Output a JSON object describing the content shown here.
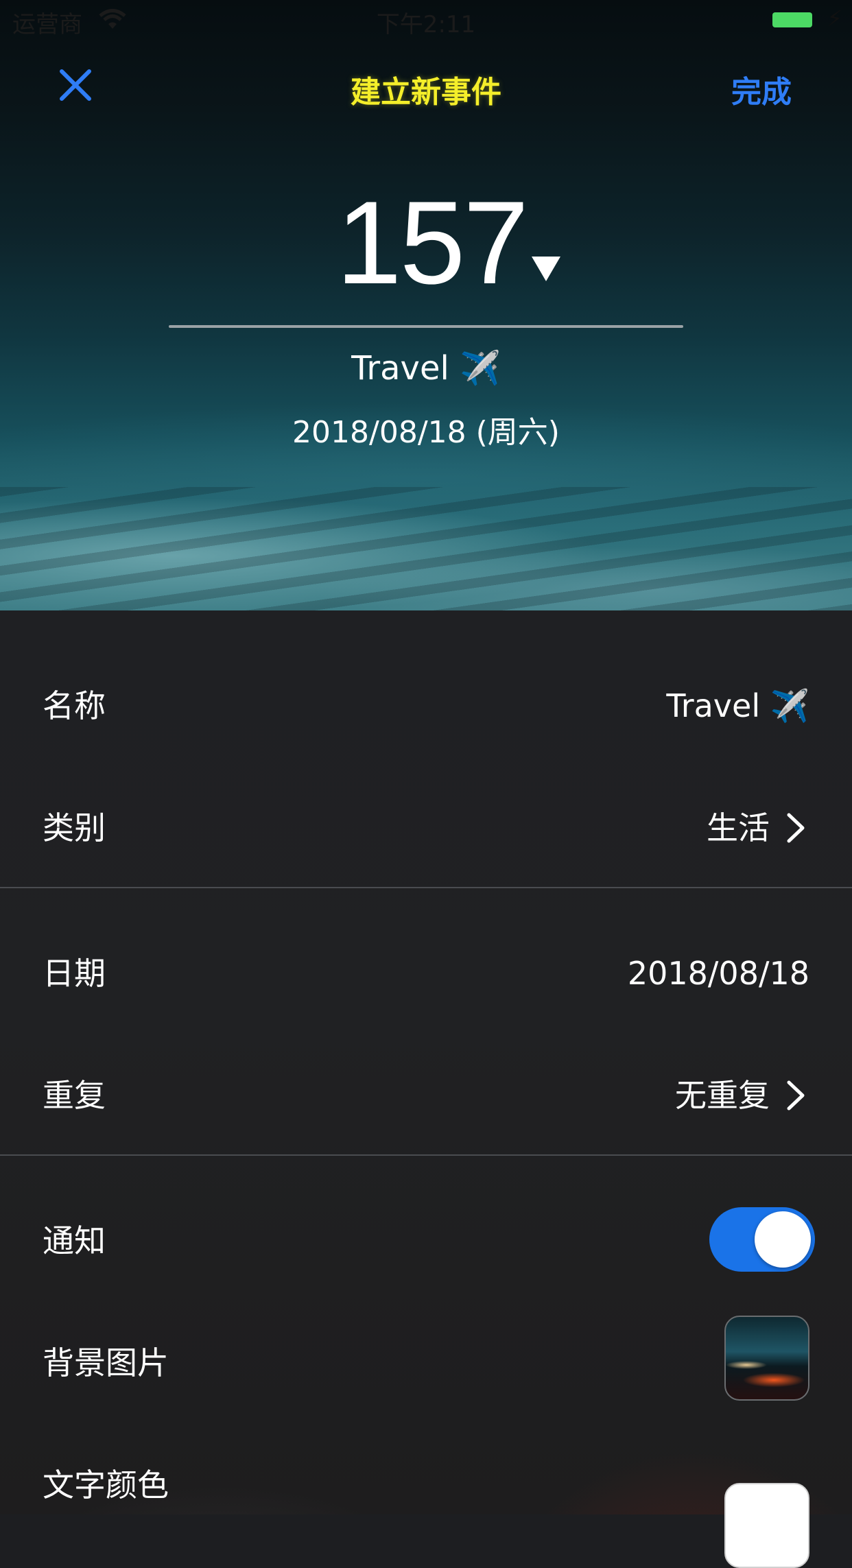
{
  "status_bar": {
    "carrier": "运营商",
    "time": "下午2:11",
    "bolt": "⚡"
  },
  "nav": {
    "title": "建立新事件",
    "done_label": "完成"
  },
  "hero": {
    "count": "157",
    "caret": "▼",
    "event_name": "Travel ✈️",
    "event_date": "2018/08/18 (周六)"
  },
  "settings": {
    "name": {
      "label": "名称",
      "value": "Travel ✈️"
    },
    "category": {
      "label": "类别",
      "value": "生活"
    },
    "date": {
      "label": "日期",
      "value": "2018/08/18"
    },
    "repeat": {
      "label": "重复",
      "value": "无重复"
    },
    "notify": {
      "label": "通知",
      "enabled": true
    },
    "background": {
      "label": "背景图片"
    },
    "text_color": {
      "label": "文字颜色",
      "color": "#ffffff"
    }
  },
  "colors": {
    "title_yellow": "#f4ee2a",
    "accent_blue": "#2f7df6",
    "toggle_blue": "#1a73e8"
  }
}
